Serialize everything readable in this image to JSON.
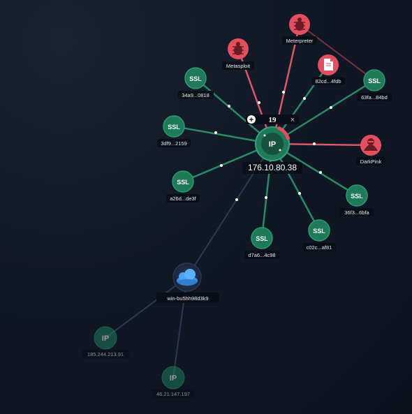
{
  "center": {
    "label": "176.10.80.38",
    "type_text": "IP",
    "count": "19"
  },
  "controls": {
    "expand_symbol": "+",
    "close_symbol": "×"
  },
  "ssl_nodes": [
    {
      "id": "ssl1",
      "label": "34a9...0818",
      "type_text": "SSL"
    },
    {
      "id": "ssl2",
      "label": "3df9...2159",
      "type_text": "SSL"
    },
    {
      "id": "ssl3",
      "label": "a26d...de3f",
      "type_text": "SSL"
    },
    {
      "id": "ssl4",
      "label": "d7a6...4c98",
      "type_text": "SSL"
    },
    {
      "id": "ssl5",
      "label": "c02c...af81",
      "type_text": "SSL"
    },
    {
      "id": "ssl6",
      "label": "36f3...6bfa",
      "type_text": "SSL"
    },
    {
      "id": "ssl7",
      "label": "63fa...84bd",
      "type_text": "SSL"
    }
  ],
  "threat_nodes": [
    {
      "id": "metasploit",
      "label": "Metasploit",
      "icon": "bug-icon"
    },
    {
      "id": "meterpreter",
      "label": "Meterpreter",
      "icon": "bug-icon"
    },
    {
      "id": "file",
      "label": "82cd...4fdb",
      "icon": "file-icon"
    },
    {
      "id": "darkpink",
      "label": "DarkPink",
      "icon": "hacker-icon"
    }
  ],
  "host_node": {
    "label": "win-bu5hh98d3k9",
    "icon": "cloud-icon"
  },
  "dim_ip_nodes": [
    {
      "id": "ipa",
      "label": "185.244.213.91",
      "type_text": "IP"
    },
    {
      "id": "ipb",
      "label": "46.21.147.197",
      "type_text": "IP"
    }
  ],
  "colors": {
    "ssl": "#1f7a5a",
    "ssl_edge": "#2a8a66",
    "threat": "#e2505f",
    "threat_edge": "#d9586a",
    "host_edge": "#2b3a52",
    "background": "#0f1420"
  }
}
